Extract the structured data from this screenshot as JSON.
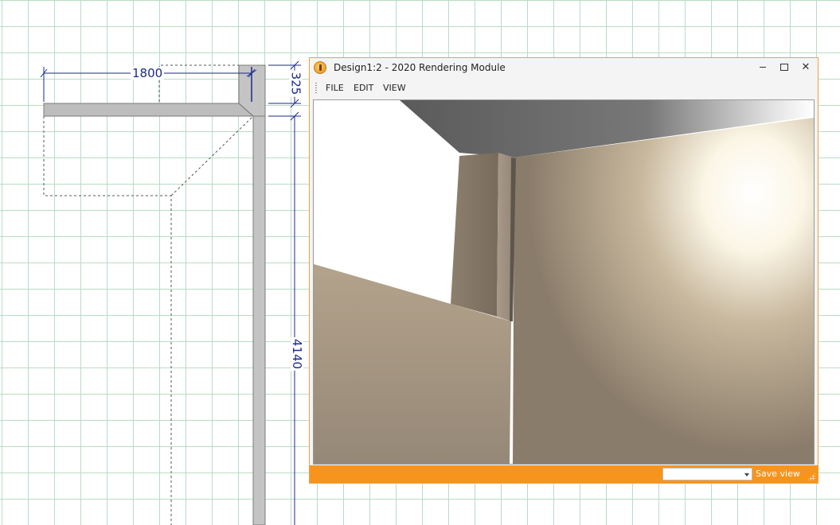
{
  "plan": {
    "dimensions": [
      {
        "id": "top-width",
        "value": "1800"
      },
      {
        "id": "depth",
        "value": "325"
      },
      {
        "id": "length",
        "value": "4140"
      }
    ]
  },
  "window": {
    "title": "Design1:2 - 2020 Rendering Module",
    "menu": [
      "FILE",
      "EDIT",
      "VIEW"
    ],
    "status": {
      "view_select_value": "",
      "save_view_label": "Save view"
    }
  }
}
